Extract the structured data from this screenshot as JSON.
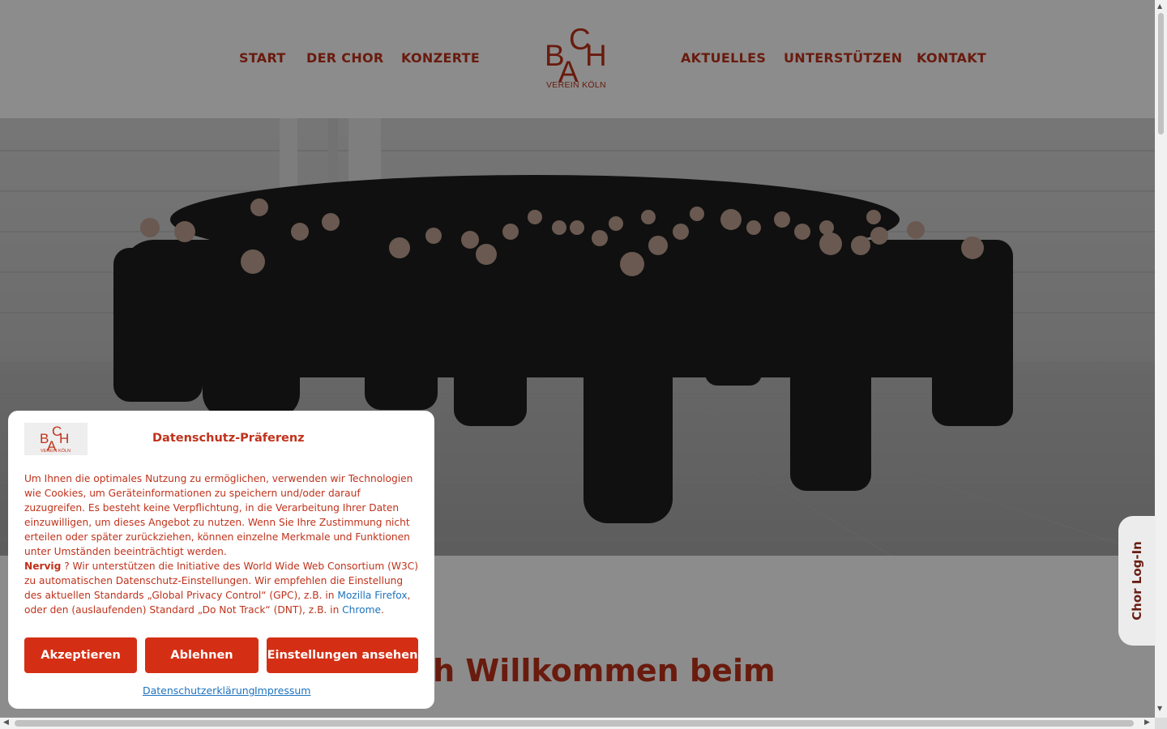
{
  "nav": {
    "left": [
      "START",
      "DER CHOR",
      "KONZERTE"
    ],
    "right": [
      "AKTUELLES",
      "UNTERSTÜTZEN",
      "KONTAKT"
    ]
  },
  "logo": {
    "letters": [
      "B",
      "A",
      "C",
      "H"
    ],
    "subtitle": "VEREIN KÖLN"
  },
  "content": {
    "welcome_heading": "zlich Willkommen beim"
  },
  "login_tab": "Chor Log-In",
  "cookie_modal": {
    "title": "Datenschutz-Präferenz",
    "logo_subtitle": "VEREIN KÖLN",
    "paragraph1": "Um Ihnen die optimales Nutzung zu ermöglichen, verwenden wir Technologien wie Cookies, um Geräteinformationen zu speichern und/oder darauf zuzugreifen. Es besteht keine Verpflichtung, in die Verarbeitung Ihrer Daten einzuwilligen, um dieses Angebot zu nutzen. Wenn Sie Ihre Zustimmung nicht erteilen oder später zurückziehen, können einzelne Merkmale und Funktionen unter Umständen beeinträchtigt werden.",
    "bold_word": "Nervig",
    "paragraph2_a": " ? Wir unterstützen die Initiative des World Wide Web Consortium (W3C) zu automatischen Datenschutz-Einstellungen. Wir empfehlen die Einstellung des aktuellen Standards „Global Privacy Control“ (GPC), z.B. in ",
    "link_firefox": "Mozilla Firefox",
    "paragraph2_b": ", oder den (auslaufenden) Standard „Do Not Track“ (DNT), z.B. in ",
    "link_chrome": "Chrome",
    "paragraph2_c": ".",
    "buttons": {
      "accept": "Akzeptieren",
      "decline": "Ablehnen",
      "settings": "Einstellungen ansehen"
    },
    "links": {
      "privacy": "Datenschutzerklärung",
      "imprint": "Impressum"
    }
  },
  "colors": {
    "brand": "#c0321b",
    "button": "#d42f14",
    "link": "#1e73be"
  }
}
